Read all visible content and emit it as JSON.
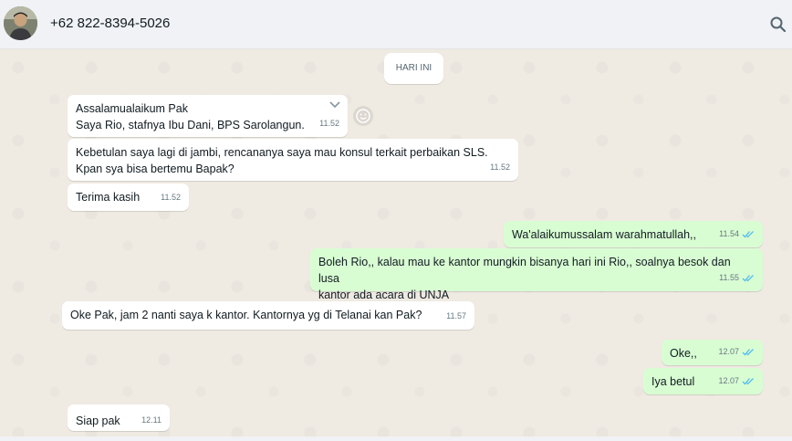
{
  "header": {
    "contact_name": "+62 822-8394-5026"
  },
  "date_chip": "HARI INI",
  "messages": [
    {
      "dir": "in",
      "lines": [
        "Assalamualaikum Pak",
        "Saya Rio, stafnya Ibu Dani, BPS Sarolangun."
      ],
      "time": "11.52"
    },
    {
      "dir": "in",
      "lines": [
        "Kebetulan saya lagi di jambi, rencananya saya mau konsul terkait perbaikan SLS.",
        "Kpan sya bisa bertemu Bapak?"
      ],
      "time": "11.52"
    },
    {
      "dir": "in",
      "lines": [
        "Terima kasih"
      ],
      "time": "11.52"
    },
    {
      "dir": "out",
      "lines": [
        "Wa'alaikumussalam warahmatullah,,"
      ],
      "time": "11.54",
      "status": "read"
    },
    {
      "dir": "out",
      "lines": [
        "Boleh Rio,, kalau mau ke kantor mungkin bisanya hari ini Rio,, soalnya besok dan lusa",
        "kantor ada acara di UNJA"
      ],
      "time": "11.55",
      "status": "read"
    },
    {
      "dir": "in",
      "lines": [
        "Oke Pak, jam 2 nanti saya k kantor. Kantornya yg di Telanai kan Pak?"
      ],
      "time": "11.57"
    },
    {
      "dir": "out",
      "lines": [
        "Oke,,"
      ],
      "time": "12.07",
      "status": "read"
    },
    {
      "dir": "out",
      "lines": [
        "Iya betul"
      ],
      "time": "12.07",
      "status": "read"
    },
    {
      "dir": "in",
      "lines": [
        "Siap pak"
      ],
      "time": "12.11"
    }
  ],
  "colors": {
    "incoming": "#ffffff",
    "outgoing": "#d9fdd3",
    "read_ticks": "#53bdeb",
    "wallpaper": "#efeae2"
  },
  "icons": [
    "search-icon",
    "chevron-down-icon",
    "emoji-icon",
    "double-check-icon"
  ]
}
